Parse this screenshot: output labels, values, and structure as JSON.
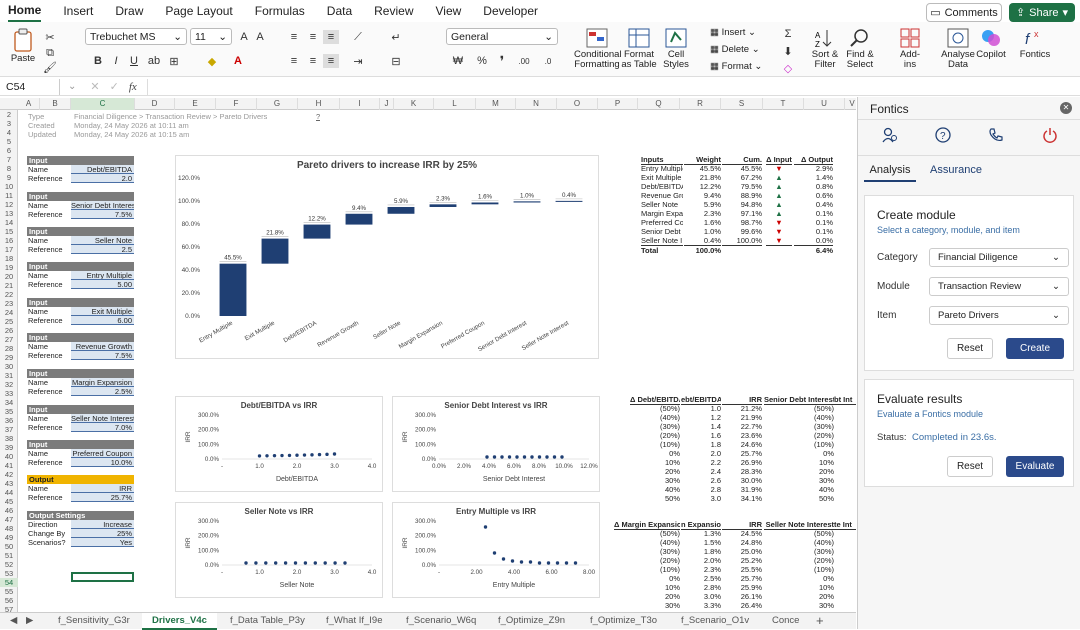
{
  "menu": [
    "Home",
    "Insert",
    "Draw",
    "Page Layout",
    "Formulas",
    "Data",
    "Review",
    "View",
    "Developer"
  ],
  "comments_label": "Comments",
  "share_label": "Share",
  "ribbon": {
    "paste": "Paste",
    "font_name": "Trebuchet MS",
    "font_size": "11",
    "number_format": "General",
    "cond_fmt": "Conditional Formatting",
    "fmt_table": "Format as Table",
    "cell_styles": "Cell Styles",
    "insert": "Insert",
    "delete": "Delete",
    "format": "Format",
    "sort_filter": "Sort & Filter",
    "find_select": "Find & Select",
    "addins": "Add-ins",
    "analyse": "Analyse Data",
    "copilot": "Copilot",
    "fontics": "Fontics"
  },
  "namebox": "C54",
  "columns": [
    "A",
    "B",
    "C",
    "D",
    "E",
    "F",
    "G",
    "H",
    "I",
    "J",
    "K",
    "L",
    "M",
    "N",
    "O",
    "P",
    "Q",
    "R",
    "S",
    "T",
    "U",
    "V"
  ],
  "header_info": {
    "type_label": "Type",
    "type_value": "Financial Diligence > Transaction Review > Pareto Drivers",
    "created_label": "Created",
    "created_value": "Monday, 24 May 2026 at 10:11 am",
    "updated_label": "Updated",
    "updated_value": "Monday, 24 May 2026 at 10:15 am",
    "help": "?"
  },
  "inputs": [
    {
      "name": "Debt/EBITDA",
      "ref": "2.0"
    },
    {
      "name": "Senior Debt Interest",
      "ref": "7.5%"
    },
    {
      "name": "Seller Note",
      "ref": "2.5"
    },
    {
      "name": "Entry Multiple",
      "ref": "5.00"
    },
    {
      "name": "Exit Multiple",
      "ref": "6.00"
    },
    {
      "name": "Revenue Growth",
      "ref": "7.5%"
    },
    {
      "name": "Margin Expansion",
      "ref": "2.5%"
    },
    {
      "name": "Seller Note Interest",
      "ref": "7.0%"
    },
    {
      "name": "Preferred Coupon",
      "ref": "10.0%"
    }
  ],
  "labels": {
    "input": "Input",
    "name": "Name",
    "reference": "Reference",
    "output": "Output",
    "output_settings": "Output Settings",
    "direction": "Direction",
    "change_by": "Change By",
    "scenarios": "Scenarios?"
  },
  "output": {
    "name": "IRR",
    "ref": "25.7%"
  },
  "settings": {
    "direction": "Increase",
    "change_by": "25%",
    "scenarios": "Yes"
  },
  "pareto": {
    "title": "Pareto drivers to increase IRR by 25%",
    "yticks": [
      "120.0%",
      "100.0%",
      "80.0%",
      "60.0%",
      "40.0%",
      "20.0%",
      "0.0%"
    ],
    "categories": [
      "Entry Multiple",
      "Exit Multiple",
      "Debt/EBITDA",
      "Revenue Growth",
      "Seller Note",
      "Margin Expansion",
      "Preferred Coupon",
      "Senior Debt Interest",
      "Seller Note Interest"
    ],
    "labels": [
      "45.5%",
      "21.8%",
      "12.2%",
      "9.4%",
      "5.9%",
      "2.3%",
      "1.6%",
      "1.0%",
      "0.4%"
    ]
  },
  "chart_data": [
    {
      "type": "bar",
      "title": "Pareto drivers to increase IRR by 25%",
      "categories": [
        "Entry Multiple",
        "Exit Multiple",
        "Debt/EBITDA",
        "Revenue Growth",
        "Seller Note",
        "Margin Expansion",
        "Preferred Coupon",
        "Senior Debt Interest",
        "Seller Note Interest"
      ],
      "values": [
        45.5,
        21.8,
        12.2,
        9.4,
        5.9,
        2.3,
        1.6,
        1.0,
        0.4
      ],
      "ylim": [
        0,
        120
      ]
    },
    {
      "type": "scatter",
      "title": "Debt/EBITDA vs IRR",
      "xlabel": "Debt/EBITDA",
      "ylabel": "IRR",
      "x": [
        1.0,
        1.2,
        1.4,
        1.6,
        1.8,
        2.0,
        2.2,
        2.4,
        2.6,
        2.8,
        3.0
      ],
      "y": [
        21.2,
        21.9,
        22.7,
        23.6,
        24.6,
        25.7,
        26.9,
        28.3,
        30.0,
        31.9,
        34.1
      ]
    },
    {
      "type": "scatter",
      "title": "Senior Debt Interest vs IRR",
      "xlabel": "Senior Debt Interest",
      "ylabel": "IRR"
    },
    {
      "type": "scatter",
      "title": "Seller Note vs IRR",
      "xlabel": "Seller Note",
      "ylabel": "IRR"
    },
    {
      "type": "scatter",
      "title": "Entry Multiple vs IRR",
      "xlabel": "Entry Multiple",
      "ylabel": "IRR"
    }
  ],
  "scatter_titles": [
    "Debt/EBITDA vs IRR",
    "Senior Debt Interest vs IRR",
    "Seller Note vs IRR",
    "Entry Multiple vs IRR"
  ],
  "scatter_xlabels": [
    "Debt/EBITDA",
    "Senior Debt Interest",
    "Seller Note",
    "Entry Multiple"
  ],
  "scatter_yticks": [
    "300.0%",
    "200.0%",
    "100.0%",
    "0.0%"
  ],
  "scatter_xticks": [
    [
      "-",
      "1.0",
      "2.0",
      "3.0",
      "4.0"
    ],
    [
      "0.0%",
      "2.0%",
      "4.0%",
      "6.0%",
      "8.0%",
      "10.0%",
      "12.0%"
    ],
    [
      "-",
      "1.0",
      "2.0",
      "3.0",
      "4.0"
    ],
    [
      "-",
      "2.00",
      "4.00",
      "6.00",
      "8.00"
    ]
  ],
  "sens_table": {
    "headers": [
      "Inputs",
      "Weight",
      "Cum.",
      "Δ Input",
      "Δ Output"
    ],
    "rows": [
      [
        "Entry Multiple",
        "45.5%",
        "45.5%",
        "▼",
        "2.9%"
      ],
      [
        "Exit Multiple",
        "21.8%",
        "67.2%",
        "▲",
        "1.4%"
      ],
      [
        "Debt/EBITDA",
        "12.2%",
        "79.5%",
        "▲",
        "0.8%"
      ],
      [
        "Revenue Growth",
        "9.4%",
        "88.9%",
        "▲",
        "0.6%"
      ],
      [
        "Seller Note",
        "5.9%",
        "94.8%",
        "▲",
        "0.4%"
      ],
      [
        "Margin Expansion",
        "2.3%",
        "97.1%",
        "▲",
        "0.1%"
      ],
      [
        "Preferred Coupon",
        "1.6%",
        "98.7%",
        "▼",
        "0.1%"
      ],
      [
        "Senior Debt",
        "1.0%",
        "99.6%",
        "▼",
        "0.1%"
      ],
      [
        "Seller Note I",
        "0.4%",
        "100.0%",
        "▼",
        "0.0%"
      ]
    ],
    "total": [
      "Total",
      "100.0%",
      "",
      "",
      "6.4%"
    ]
  },
  "debt_table": {
    "headers": [
      "Δ Debt/EBITDA",
      "ebt/EBITDA",
      "IRR",
      "Senior Debt Interest",
      "bt Int"
    ],
    "rows": [
      [
        "(50%)",
        "1.0",
        "21.2%",
        "(50%)"
      ],
      [
        "(40%)",
        "1.2",
        "21.9%",
        "(40%)"
      ],
      [
        "(30%)",
        "1.4",
        "22.7%",
        "(30%)"
      ],
      [
        "(20%)",
        "1.6",
        "23.6%",
        "(20%)"
      ],
      [
        "(10%)",
        "1.8",
        "24.6%",
        "(10%)"
      ],
      [
        "0%",
        "2.0",
        "25.7%",
        "0%"
      ],
      [
        "10%",
        "2.2",
        "26.9%",
        "10%"
      ],
      [
        "20%",
        "2.4",
        "28.3%",
        "20%"
      ],
      [
        "30%",
        "2.6",
        "30.0%",
        "30%"
      ],
      [
        "40%",
        "2.8",
        "31.9%",
        "40%"
      ],
      [
        "50%",
        "3.0",
        "34.1%",
        "50%"
      ]
    ]
  },
  "margin_table": {
    "headers": [
      "Δ Margin Expansion",
      "n Expansion",
      "IRR",
      "Seller Note Interest",
      "te Int"
    ],
    "rows": [
      [
        "(50%)",
        "1.3%",
        "24.5%",
        "(50%)"
      ],
      [
        "(40%)",
        "1.5%",
        "24.8%",
        "(40%)"
      ],
      [
        "(30%)",
        "1.8%",
        "25.0%",
        "(30%)"
      ],
      [
        "(20%)",
        "2.0%",
        "25.2%",
        "(20%)"
      ],
      [
        "(10%)",
        "2.3%",
        "25.5%",
        "(10%)"
      ],
      [
        "0%",
        "2.5%",
        "25.7%",
        "0%"
      ],
      [
        "10%",
        "2.8%",
        "25.9%",
        "10%"
      ],
      [
        "20%",
        "3.0%",
        "26.1%",
        "20%"
      ],
      [
        "30%",
        "3.3%",
        "26.4%",
        "30%"
      ]
    ]
  },
  "sheet_tabs": [
    "f_Sensitivity_G3r",
    "Drivers_V4c",
    "f_Data Table_P3y",
    "f_What If_I9e",
    "f_Scenario_W6q",
    "f_Optimize_Z9n",
    "f_Optimize_T3o",
    "f_Scenario_O1v",
    "Conce"
  ],
  "fontics": {
    "title": "Fontics",
    "tab_analysis": "Analysis",
    "tab_assurance": "Assurance",
    "create_title": "Create module",
    "create_sub": "Select a category, module, and item",
    "category_label": "Category",
    "category_value": "Financial Diligence",
    "module_label": "Module",
    "module_value": "Transaction Review",
    "item_label": "Item",
    "item_value": "Pareto Drivers",
    "reset": "Reset",
    "create": "Create",
    "eval_title": "Evaluate results",
    "eval_sub": "Evaluate a Fontics module",
    "status_label": "Status:",
    "status_value": "Completed in 23.6s.",
    "evaluate": "Evaluate"
  },
  "colors": {
    "accent": "#1e7145",
    "navy": "#1f3f73",
    "button": "#2b4a8b"
  }
}
